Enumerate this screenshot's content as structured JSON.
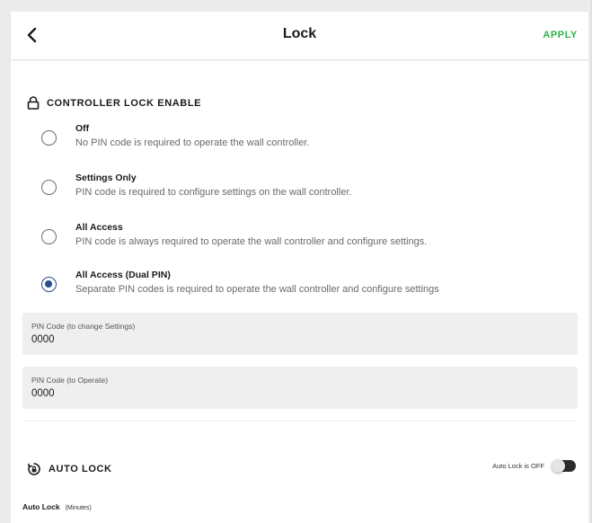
{
  "header": {
    "title": "Lock",
    "apply_label": "APPLY"
  },
  "controller_lock": {
    "section_label": "CONTROLLER LOCK ENABLE",
    "options": [
      {
        "title": "Off",
        "description": "No PIN code is required to operate the wall controller.",
        "selected": false
      },
      {
        "title": "Settings Only",
        "description": "PIN code is required to configure settings on the wall controller.",
        "selected": false
      },
      {
        "title": "All Access",
        "description": "PIN code is always required to operate the wall controller and configure settings.",
        "selected": false
      },
      {
        "title": "All Access (Dual PIN)",
        "description": "Separate PIN codes is required to operate the wall controller and configure settings",
        "selected": true
      }
    ]
  },
  "pin_fields": [
    {
      "label": "PIN Code (to change Settings)",
      "value": "0000"
    },
    {
      "label": "PIN Code (to Operate)",
      "value": "0000"
    }
  ],
  "auto_lock": {
    "section_label": "AUTO LOCK",
    "toggle_label": "Auto Lock is OFF",
    "toggle_on": false,
    "field_label": "Auto Lock",
    "field_unit": "(Minutes)"
  },
  "colors": {
    "accent_green": "#2bb34a",
    "radio_selected": "#2c4a8e",
    "field_bg": "#efefef"
  },
  "icons": {
    "back": "chevron-left-icon",
    "lock": "lock-icon",
    "auto_lock": "timer-lock-icon"
  }
}
